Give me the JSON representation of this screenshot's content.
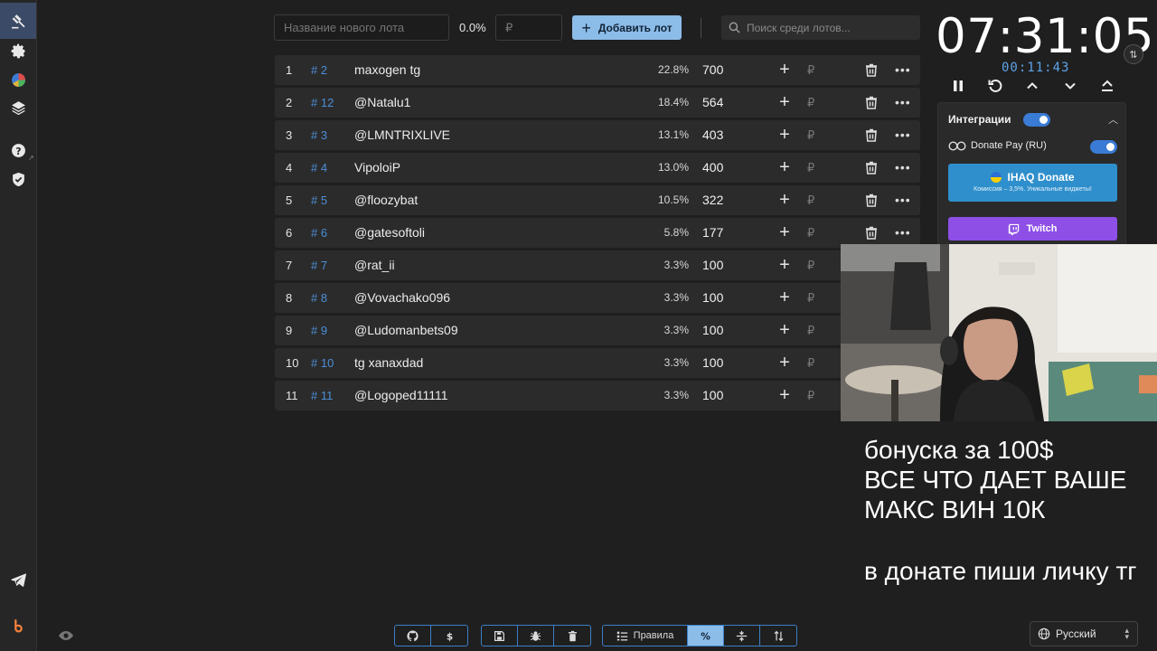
{
  "toolbar": {
    "new_lot_placeholder": "Название нового лота",
    "total_percent": "0.0%",
    "amount_placeholder": "₽",
    "add_label": "Добавить лот",
    "search_placeholder": "Поиск среди лотов..."
  },
  "lots": [
    {
      "index": "1",
      "id": "# 2",
      "name": "maxogen tg",
      "percent": "22.8%",
      "amount": "700",
      "currency": "₽",
      "deletable": true
    },
    {
      "index": "2",
      "id": "# 12",
      "name": "@Natalu1",
      "percent": "18.4%",
      "amount": "564",
      "currency": "₽",
      "deletable": true
    },
    {
      "index": "3",
      "id": "# 3",
      "name": "@LMNTRIXLIVE",
      "percent": "13.1%",
      "amount": "403",
      "currency": "₽",
      "deletable": true
    },
    {
      "index": "4",
      "id": "# 4",
      "name": "VipoloiP",
      "percent": "13.0%",
      "amount": "400",
      "currency": "₽",
      "deletable": true
    },
    {
      "index": "5",
      "id": "# 5",
      "name": "@floozybat",
      "percent": "10.5%",
      "amount": "322",
      "currency": "₽",
      "deletable": true
    },
    {
      "index": "6",
      "id": "# 6",
      "name": "@gatesoftoli",
      "percent": "5.8%",
      "amount": "177",
      "currency": "₽",
      "deletable": true
    },
    {
      "index": "7",
      "id": "# 7",
      "name": "@rat_ii",
      "percent": "3.3%",
      "amount": "100",
      "currency": "₽",
      "deletable": false
    },
    {
      "index": "8",
      "id": "# 8",
      "name": "@Vovachako096",
      "percent": "3.3%",
      "amount": "100",
      "currency": "₽",
      "deletable": false
    },
    {
      "index": "9",
      "id": "# 9",
      "name": "@Ludomanbets09",
      "percent": "3.3%",
      "amount": "100",
      "currency": "₽",
      "deletable": false
    },
    {
      "index": "10",
      "id": "# 10",
      "name": "tg xanaxdad",
      "percent": "3.3%",
      "amount": "100",
      "currency": "₽",
      "deletable": false
    },
    {
      "index": "11",
      "id": "# 11",
      "name": "@Logoped11111",
      "percent": "3.3%",
      "amount": "100",
      "currency": "₽",
      "deletable": false
    }
  ],
  "timer": {
    "main": "07:31:05",
    "sub": "00:11:43"
  },
  "integrations": {
    "title": "Интеграции",
    "donate_pay_label": "Donate Pay (RU)",
    "ihaq_title": "IHAQ Donate",
    "ihaq_subtitle": "Комиссия – 3,5%. Уникальные виджеты!",
    "twitch_label": "Twitch"
  },
  "overlay": {
    "line1": "бонуска за 100$",
    "line2": "ВСЕ ЧТО ДАЕТ ВАШЕ",
    "line3": "МАКС ВИН 10К",
    "line4": "в донате пиши личку тг"
  },
  "bottom": {
    "rules_label": "Правила"
  },
  "language": {
    "selected": "Русский"
  },
  "colors": {
    "accent": "#8cbce8",
    "lot_id": "#4c8ed6",
    "twitch": "#8d4fe6",
    "ihaq": "#2f8fcc"
  }
}
